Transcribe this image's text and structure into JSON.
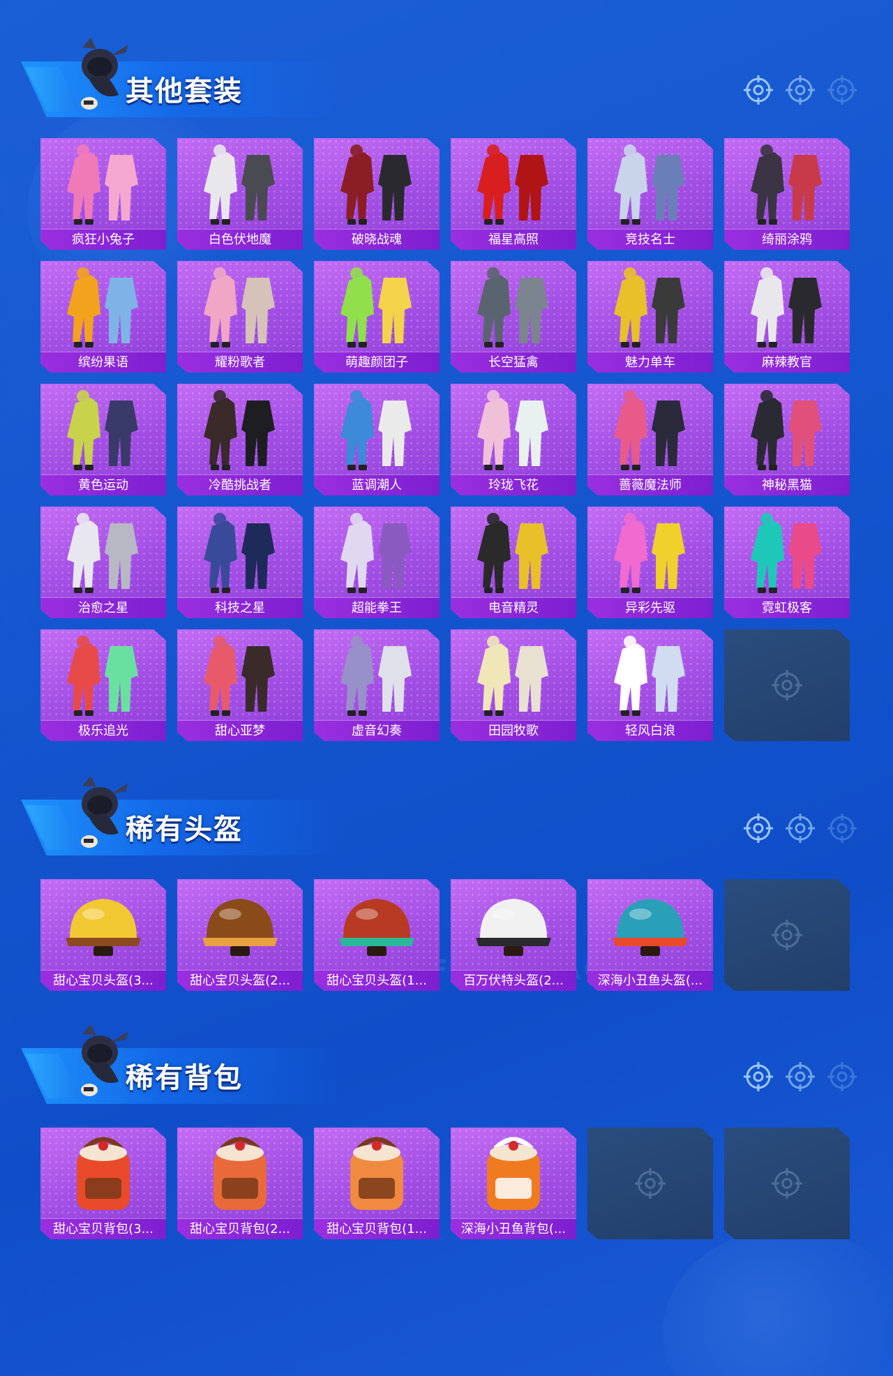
{
  "watermark": "GAME FOR PEACE",
  "colors": {
    "background": "#1456cf",
    "card": "#a24ee4",
    "label_bar": "#8a27d9",
    "empty_slot": "#243f6b"
  },
  "sections": {
    "outfits": {
      "title": "其他套装",
      "items": [
        {
          "label": "疯狂小兔子",
          "art": "outfit"
        },
        {
          "label": "白色伏地魔",
          "art": "outfit"
        },
        {
          "label": "破晓战魂",
          "art": "outfit"
        },
        {
          "label": "福星高照",
          "art": "outfit"
        },
        {
          "label": "竞技名士",
          "art": "outfit"
        },
        {
          "label": "绮丽涂鸦",
          "art": "outfit"
        },
        {
          "label": "缤纷果语",
          "art": "outfit"
        },
        {
          "label": "耀粉歌者",
          "art": "outfit"
        },
        {
          "label": "萌趣颜团子",
          "art": "outfit"
        },
        {
          "label": "长空猛禽",
          "art": "outfit"
        },
        {
          "label": "魅力单车",
          "art": "outfit"
        },
        {
          "label": "麻辣教官",
          "art": "outfit"
        },
        {
          "label": "黄色运动",
          "art": "outfit"
        },
        {
          "label": "冷酷挑战者",
          "art": "outfit"
        },
        {
          "label": "蓝调潮人",
          "art": "outfit"
        },
        {
          "label": "玲珑飞花",
          "art": "outfit"
        },
        {
          "label": "蔷薇魔法师",
          "art": "outfit"
        },
        {
          "label": "神秘黑猫",
          "art": "outfit"
        },
        {
          "label": "治愈之星",
          "art": "outfit"
        },
        {
          "label": "科技之星",
          "art": "outfit"
        },
        {
          "label": "超能拳王",
          "art": "outfit"
        },
        {
          "label": "电音精灵",
          "art": "outfit"
        },
        {
          "label": "异彩先驱",
          "art": "outfit"
        },
        {
          "label": "霓虹极客",
          "art": "outfit"
        },
        {
          "label": "极乐追光",
          "art": "outfit"
        },
        {
          "label": "甜心亚梦",
          "art": "outfit"
        },
        {
          "label": "虚音幻奏",
          "art": "outfit"
        },
        {
          "label": "田园牧歌",
          "art": "outfit"
        },
        {
          "label": "轻风白浪",
          "art": "outfit"
        }
      ],
      "empty_slots": 1
    },
    "helmets": {
      "title": "稀有头盔",
      "items": [
        {
          "label": "甜心宝贝头盔(3...",
          "art": "helmet"
        },
        {
          "label": "甜心宝贝头盔(2...",
          "art": "helmet"
        },
        {
          "label": "甜心宝贝头盔(1...",
          "art": "helmet"
        },
        {
          "label": "百万伏特头盔(2...",
          "art": "helmet"
        },
        {
          "label": "深海小丑鱼头盔(...",
          "art": "helmet"
        }
      ],
      "empty_slots": 1
    },
    "backpacks": {
      "title": "稀有背包",
      "items": [
        {
          "label": "甜心宝贝背包(3...",
          "art": "backpack"
        },
        {
          "label": "甜心宝贝背包(2...",
          "art": "backpack"
        },
        {
          "label": "甜心宝贝背包(1...",
          "art": "backpack"
        },
        {
          "label": "深海小丑鱼背包(...",
          "art": "backpack"
        }
      ],
      "empty_slots": 2
    }
  },
  "outfit_palettes": [
    [
      "#f07ab8",
      "#f4a8d0"
    ],
    [
      "#e8e8ec",
      "#4a4a52"
    ],
    [
      "#8b1e24",
      "#2a2a2e"
    ],
    [
      "#d81e1e",
      "#b01414"
    ],
    [
      "#c8d4ea",
      "#6a7fb8"
    ],
    [
      "#3a3444",
      "#c83a4a"
    ],
    [
      "#f2a21c",
      "#7fb3e8"
    ],
    [
      "#f0a6c4",
      "#d6c2b8"
    ],
    [
      "#8fe04a",
      "#f3d34a"
    ],
    [
      "#5a6470",
      "#7b8590"
    ],
    [
      "#e8c02a",
      "#3a3a3a"
    ],
    [
      "#e8e8ec",
      "#2a2a2e"
    ],
    [
      "#c8d24a",
      "#3a3a6a"
    ],
    [
      "#3a2a2a",
      "#1e1e22"
    ],
    [
      "#3c8ad8",
      "#eaeaea"
    ],
    [
      "#f0c0d8",
      "#e8f0f0"
    ],
    [
      "#e85a8a",
      "#2a2a3a"
    ],
    [
      "#2a2a34",
      "#e0507a"
    ],
    [
      "#e8e6ee",
      "#b8b8c4"
    ],
    [
      "#3a4a9a",
      "#1e2a5a"
    ],
    [
      "#e0d8f0",
      "#8a5ac0"
    ],
    [
      "#2a2a2a",
      "#e8c02a"
    ],
    [
      "#f06ad0",
      "#f0d02a"
    ],
    [
      "#1ec8b8",
      "#e84a8a"
    ],
    [
      "#e84a4a",
      "#6ae0a0"
    ],
    [
      "#e85a6a",
      "#3a2a2a"
    ],
    [
      "#9890c8",
      "#e0e0ea"
    ],
    [
      "#f0e6b8",
      "#e8e0d0"
    ],
    [
      "#ffffff",
      "#d0dcf0"
    ]
  ],
  "helmet_palettes": [
    [
      "#f2c832",
      "#8b4a20"
    ],
    [
      "#8a4a1a",
      "#e8a040"
    ],
    [
      "#b83a22",
      "#2ab89a"
    ],
    [
      "#f0f0f0",
      "#2a2a2e"
    ],
    [
      "#2aa0b8",
      "#e84a2a"
    ]
  ],
  "backpack_palettes": [
    [
      "#e84a2a",
      "#7a3a1a"
    ],
    [
      "#e86a3a",
      "#7a3a1a"
    ],
    [
      "#f08a40",
      "#7a3a1a"
    ],
    [
      "#f07a20",
      "#ffffff"
    ]
  ]
}
